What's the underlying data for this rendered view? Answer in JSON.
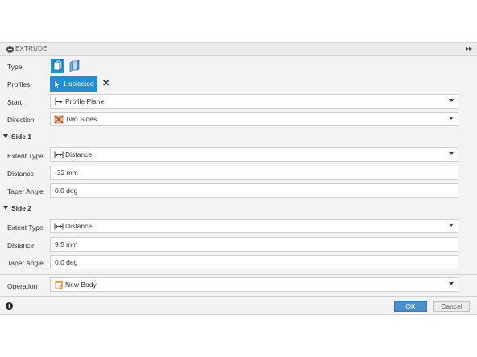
{
  "dialog": {
    "title": "EXTRUDE",
    "expand_glyph": "▸▸"
  },
  "type": {
    "label": "Type",
    "options": [
      "solid-extrude-icon",
      "thin-extrude-icon"
    ]
  },
  "profiles": {
    "label": "Profiles",
    "selection": "1 selected",
    "clear_glyph": "✕"
  },
  "start": {
    "label": "Start",
    "value": "Profile Plane",
    "icon": "profile-plane-icon"
  },
  "direction": {
    "label": "Direction",
    "value": "Two Sides",
    "icon": "two-sides-icon"
  },
  "side1": {
    "heading": "Side 1",
    "extent_type": {
      "label": "Extent Type",
      "value": "Distance",
      "icon": "distance-icon"
    },
    "distance": {
      "label": "Distance",
      "value": "-32 mm"
    },
    "taper_angle": {
      "label": "Taper Angle",
      "value": "0.0 deg"
    }
  },
  "side2": {
    "heading": "Side 2",
    "extent_type": {
      "label": "Extent Type",
      "value": "Distance",
      "icon": "distance-icon"
    },
    "distance": {
      "label": "Distance",
      "value": "9.5 mm"
    },
    "taper_angle": {
      "label": "Taper Angle",
      "value": "0.0 deg"
    }
  },
  "operation": {
    "label": "Operation",
    "value": "New Body",
    "icon": "new-body-icon"
  },
  "footer": {
    "ok_label": "OK",
    "cancel_label": "Cancel",
    "info_glyph": "i"
  },
  "colors": {
    "accent": "#1e91d6",
    "ok_button": "#4c8fcf",
    "panel": "#f3f3f3"
  }
}
